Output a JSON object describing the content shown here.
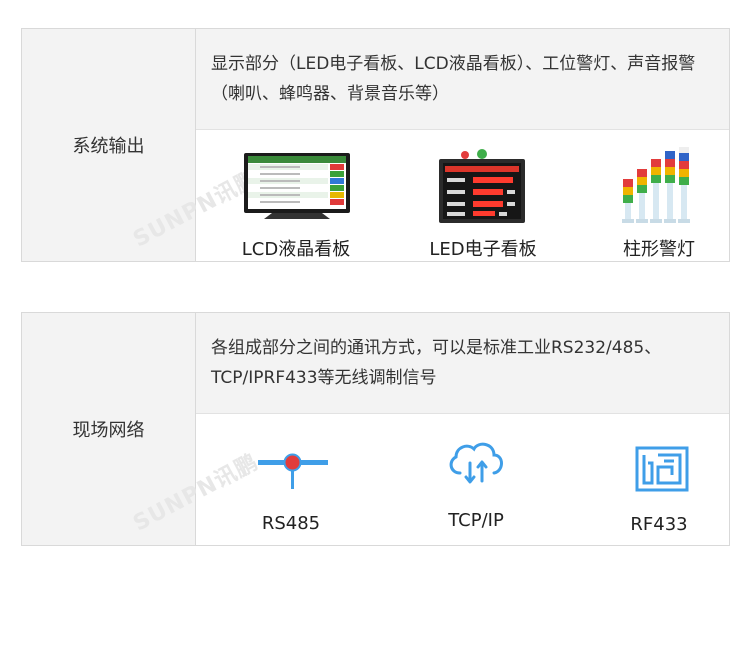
{
  "sections": [
    {
      "label": "系统输出",
      "description": "显示部分（LED电子看板、LCD液晶看板）、工位警灯、声音报警（喇叭、蜂鸣器、背景音乐等）",
      "items": [
        {
          "caption": "LCD液晶看板",
          "icon": "lcd-screen-icon"
        },
        {
          "caption": "LED电子看板",
          "icon": "led-board-icon"
        },
        {
          "caption": "柱形警灯",
          "icon": "tower-light-icon"
        }
      ]
    },
    {
      "label": "现场网络",
      "description": "各组成部分之间的通讯方式，可以是标准工业RS232/485、TCP/IPRF433等无线调制信号",
      "items": [
        {
          "caption": "RS485",
          "icon": "rs485-icon"
        },
        {
          "caption": "TCP/IP",
          "icon": "cloud-icon"
        },
        {
          "caption": "RF433",
          "icon": "rf433-icon"
        }
      ]
    }
  ],
  "colors": {
    "accent": "#3f9ee8",
    "red": "#e23c3c",
    "panel": "#f3f3f3"
  }
}
